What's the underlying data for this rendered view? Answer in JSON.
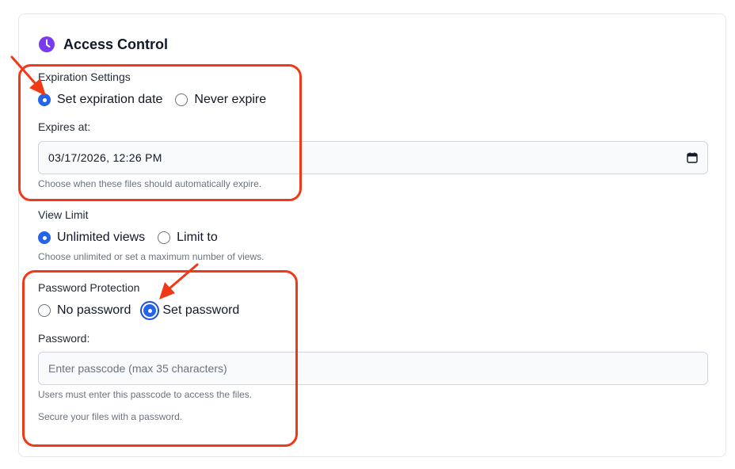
{
  "section": {
    "title": "Access Control",
    "icon": "clock-icon",
    "accent_color": "#7c3aed"
  },
  "expiration": {
    "label": "Expiration Settings",
    "options": [
      {
        "label": "Set expiration date",
        "checked": true
      },
      {
        "label": "Never expire",
        "checked": false
      }
    ],
    "field_label": "Expires at:",
    "value": "03/17/2026, 12:26 PM",
    "hint": "Choose when these files should automatically expire."
  },
  "view_limit": {
    "label": "View Limit",
    "options": [
      {
        "label": "Unlimited views",
        "checked": true
      },
      {
        "label": "Limit to",
        "checked": false
      }
    ],
    "hint": "Choose unlimited or set a maximum number of views."
  },
  "password": {
    "label": "Password Protection",
    "options": [
      {
        "label": "No password",
        "checked": false
      },
      {
        "label": "Set password",
        "checked": true
      }
    ],
    "field_label": "Password:",
    "placeholder": "Enter passcode (max 35 characters)",
    "hint_1": "Users must enter this passcode to access the files.",
    "hint_2": "Secure your files with a password."
  },
  "colors": {
    "radio_checked": "#2563eb",
    "annotation": "#f03a17"
  }
}
